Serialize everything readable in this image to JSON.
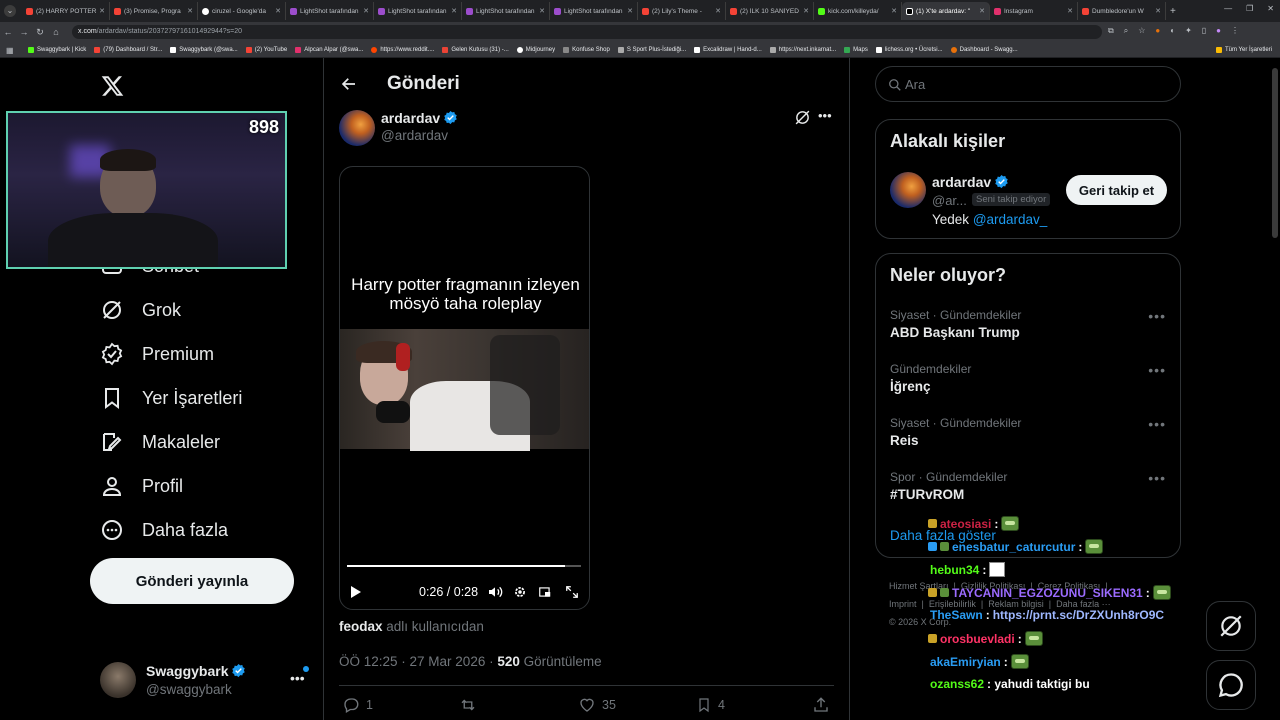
{
  "browser": {
    "tabs": [
      "(2) HARRY POTTER",
      "(3) Promise, Progra",
      "ciruzel - Google'da",
      "LightShot tarafından",
      "LightShot tarafından",
      "LightShot tarafından",
      "LightShot tarafından",
      "(2) Lily's Theme -",
      "(2) İLK 10 SANİYED",
      "kick.com/killeyda/",
      "(1) X'te ardardav: \"",
      "Instagram",
      "Dumbledore'un W"
    ],
    "url_domain": "x.com",
    "url_path": "/ardardav/status/2037279716101492944?s=20",
    "bookmarks": [
      "Swaggybark | Kick",
      "(79) Dashboard / Str...",
      "Swaggybark (@swa...",
      "(2) YouTube",
      "Alpcan Alpar (@swa...",
      "https://www.reddit....",
      "Gelen Kutusu (31) -...",
      "Midjourney",
      "Konfuse Shop",
      "S Sport Plus-İstediği...",
      "Excalidraw | Hand-d...",
      "https://next.inkarnat...",
      "Maps",
      "lichess.org • Ücretsi...",
      "Dashboard - Swagg..."
    ],
    "all_bookmarks": "Tüm Yer İşaretleri"
  },
  "webcam": {
    "counter": "898"
  },
  "nav": {
    "items": [
      "Sohbet",
      "Grok",
      "Premium",
      "Yer İşaretleri",
      "Makaleler",
      "Profil",
      "Daha fazla"
    ],
    "post_button": "Gönderi yayınla"
  },
  "account": {
    "name": "Swaggybark",
    "handle": "@swaggybark"
  },
  "post": {
    "header": "Gönderi",
    "author": {
      "name": "ardardav",
      "handle": "@ardardav"
    },
    "video": {
      "caption_line1": "Harry potter fragmanın izleyen",
      "caption_line2": "mösyö taha roleplay",
      "time": "0:26 / 0:28",
      "progress": 0.93
    },
    "attribution": {
      "user": "feodax",
      "suffix": "adlı kullanıcıdan"
    },
    "timestamp": "ÖÖ 12:25 · 27 Mar 2026",
    "views": "520",
    "views_label": " Görüntüleme",
    "stats": {
      "replies": "1",
      "likes": "35",
      "bookmarks": "4"
    }
  },
  "search": {
    "placeholder": "Ara"
  },
  "related": {
    "title": "Alakalı kişiler",
    "person": {
      "name": "ardardav",
      "handle": "@ar...",
      "follows_you": "Seni takip ediyor",
      "follow_button": "Geri takip et",
      "bio_prefix": "Yedek",
      "bio_mention": "@ardardav_"
    }
  },
  "trends": {
    "title": "Neler oluyor?",
    "items": [
      {
        "category": "Siyaset · Gündemdekiler",
        "title": "ABD Başkanı Trump"
      },
      {
        "category": "Gündemdekiler",
        "title": "İğrenç"
      },
      {
        "category": "Siyaset · Gündemdekiler",
        "title": "Reis"
      },
      {
        "category": "Spor · Gündemdekiler",
        "title": "#TURvROM"
      }
    ],
    "show_more": "Daha fazla göster"
  },
  "footer": {
    "links": [
      "Hizmet Şartları",
      "Gizlilik Politikası",
      "Çerez Politikası",
      "Imprint",
      "Erişilebilirlik",
      "Reklam bilgisi",
      "Daha fazla ···"
    ],
    "copyright": "© 2026 X Corp."
  },
  "chat": [
    {
      "user": "ateosiasi",
      "text": ":"
    },
    {
      "user": "enesbatur_caturcutur",
      "text": ":"
    },
    {
      "user": "hebun34",
      "text": ":"
    },
    {
      "user": "TAYCANIN_EGZOZUNU_SIKEN31",
      "text": ":"
    },
    {
      "user": "TheSawn",
      "text": ":",
      "link": "https://prnt.sc/DrZXUnh8rO9C"
    },
    {
      "user": "orosbuevladi",
      "text": ":"
    },
    {
      "user": "akaEmiryian",
      "text": ":"
    },
    {
      "user": "ozanss62",
      "text": ": yahudi taktigi bu"
    }
  ]
}
